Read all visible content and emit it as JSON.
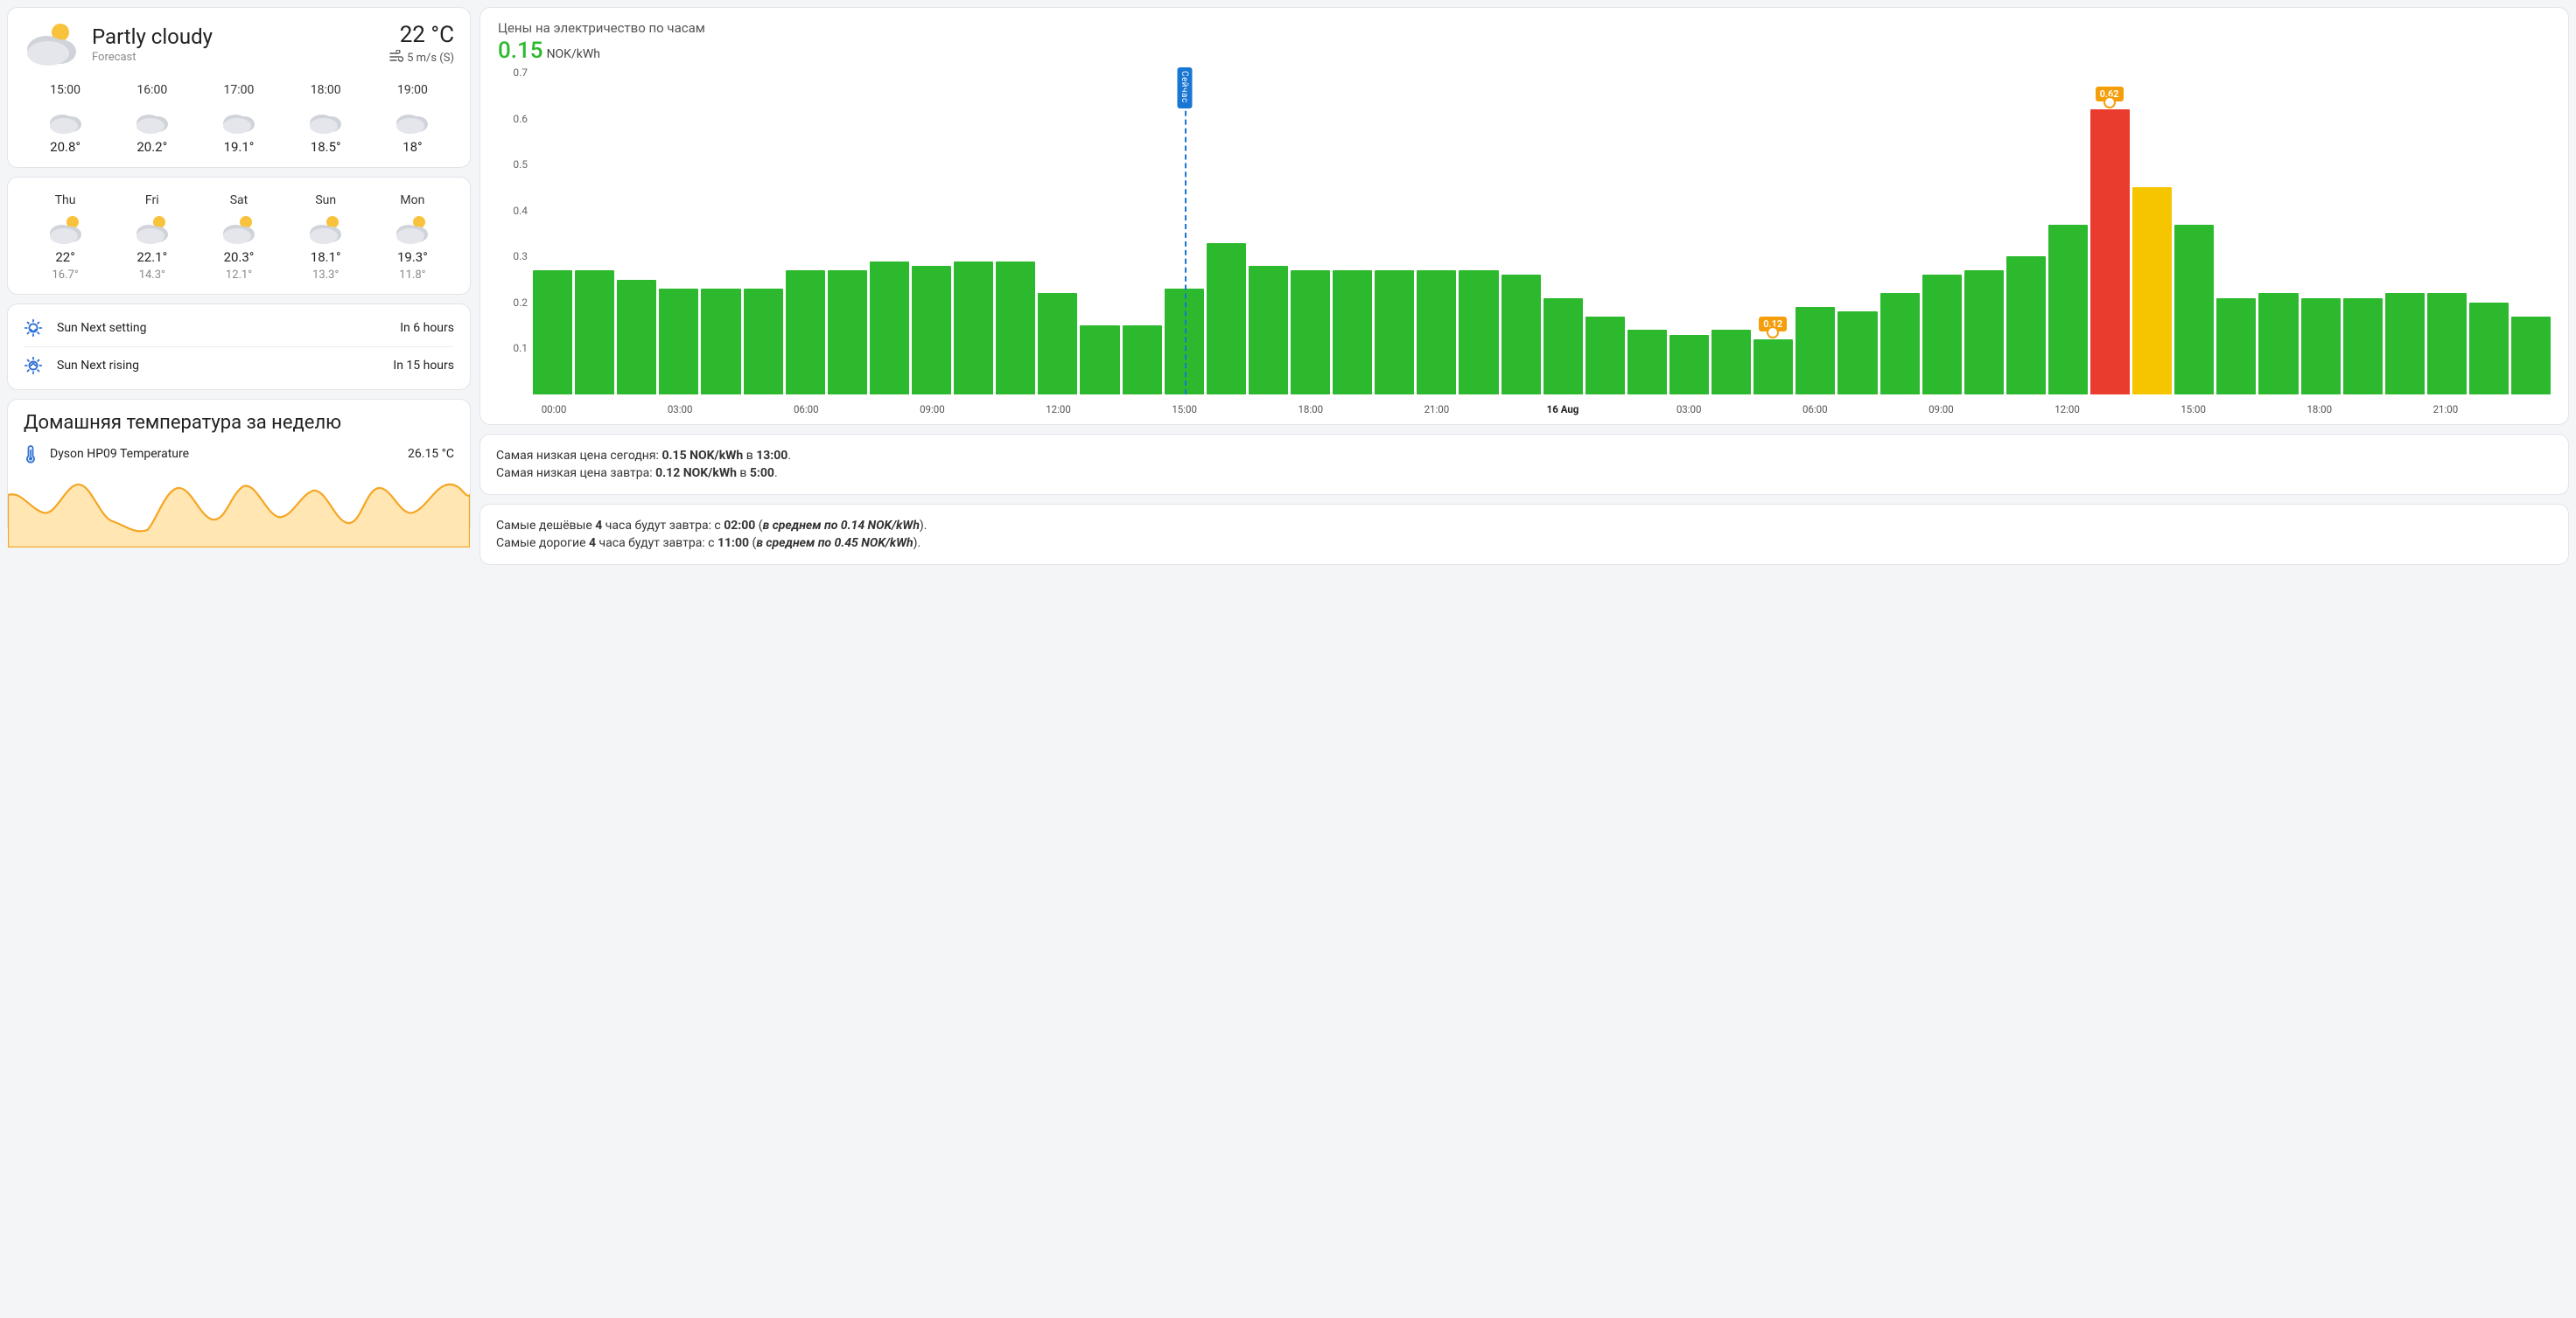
{
  "weather": {
    "condition": "Partly cloudy",
    "subtitle": "Forecast",
    "temp": "22 °C",
    "wind": "5 m/s (S)",
    "hourly": [
      {
        "time": "15:00",
        "temp": "20.8°"
      },
      {
        "time": "16:00",
        "temp": "20.2°"
      },
      {
        "time": "17:00",
        "temp": "19.1°"
      },
      {
        "time": "18:00",
        "temp": "18.5°"
      },
      {
        "time": "19:00",
        "temp": "18°"
      }
    ],
    "daily": [
      {
        "day": "Thu",
        "hi": "22°",
        "lo": "16.7°"
      },
      {
        "day": "Fri",
        "hi": "22.1°",
        "lo": "14.3°"
      },
      {
        "day": "Sat",
        "hi": "20.3°",
        "lo": "12.1°"
      },
      {
        "day": "Sun",
        "hi": "18.1°",
        "lo": "13.3°"
      },
      {
        "day": "Mon",
        "hi": "19.3°",
        "lo": "11.8°"
      }
    ]
  },
  "sun": {
    "setting_label": "Sun Next setting",
    "setting_value": "In 6 hours",
    "rising_label": "Sun Next rising",
    "rising_value": "In 15 hours"
  },
  "home_temp": {
    "card_title": "Домашняя температура за неделю",
    "sensor_label": "Dyson HP09 Temperature",
    "sensor_value": "26.15 °C"
  },
  "chart_data": {
    "type": "bar",
    "title": "Цены на электричество по часам",
    "current_value": "0.15",
    "unit": "NOK/kWh",
    "ylabel": "",
    "ylim": [
      0,
      0.7
    ],
    "y_ticks": [
      0.1,
      0.2,
      0.3,
      0.4,
      0.5,
      0.6,
      0.7
    ],
    "x_ticks": [
      "00:00",
      "03:00",
      "06:00",
      "09:00",
      "12:00",
      "15:00",
      "18:00",
      "21:00",
      "16 Aug",
      "03:00",
      "06:00",
      "09:00",
      "12:00",
      "15:00",
      "18:00",
      "21:00"
    ],
    "x_tick_bold_index": 8,
    "now_label": "Сейчас",
    "now_index": 15,
    "categories_count": 48,
    "values": [
      0.27,
      0.27,
      0.25,
      0.23,
      0.23,
      0.23,
      0.27,
      0.27,
      0.29,
      0.28,
      0.29,
      0.29,
      0.22,
      0.15,
      0.15,
      0.23,
      0.33,
      0.28,
      0.27,
      0.27,
      0.27,
      0.27,
      0.27,
      0.26,
      0.21,
      0.17,
      0.14,
      0.13,
      0.14,
      0.12,
      0.19,
      0.18,
      0.22,
      0.26,
      0.27,
      0.3,
      0.37,
      0.62,
      0.45,
      0.37,
      0.21,
      0.22,
      0.21,
      0.21,
      0.22,
      0.22,
      0.2,
      0.17
    ],
    "highlight_max": {
      "index": 37,
      "value": 0.62,
      "label": "0.62",
      "color": "red"
    },
    "highlight_second": {
      "index": 38,
      "color": "yellow"
    },
    "highlight_min": {
      "index": 29,
      "value": 0.12,
      "label": "0.12"
    }
  },
  "summary_today": {
    "line1_prefix": "Самая низкая цена сегодня: ",
    "line1_price": "0.15 NOK/kWh",
    "line1_mid": " в ",
    "line1_time": "13:00",
    "line2_prefix": "Самая низкая цена завтра: ",
    "line2_price": "0.12 NOK/kWh",
    "line2_mid": " в ",
    "line2_time": "5:00"
  },
  "summary_periods": {
    "cheap_prefix": "Самые дешёвые ",
    "cheap_hours": "4",
    "cheap_mid1": " часа будут завтра: с ",
    "cheap_time": "02:00",
    "cheap_mid2": " (",
    "cheap_avg": "в среднем по 0.14 NOK/kWh",
    "cheap_suffix": ").",
    "exp_prefix": "Самые дорогие ",
    "exp_hours": "4",
    "exp_mid1": " часа будут завтра: с ",
    "exp_time": "11:00",
    "exp_mid2": " (",
    "exp_avg": "в среднем по 0.45 NOK/kWh",
    "exp_suffix": ")."
  }
}
